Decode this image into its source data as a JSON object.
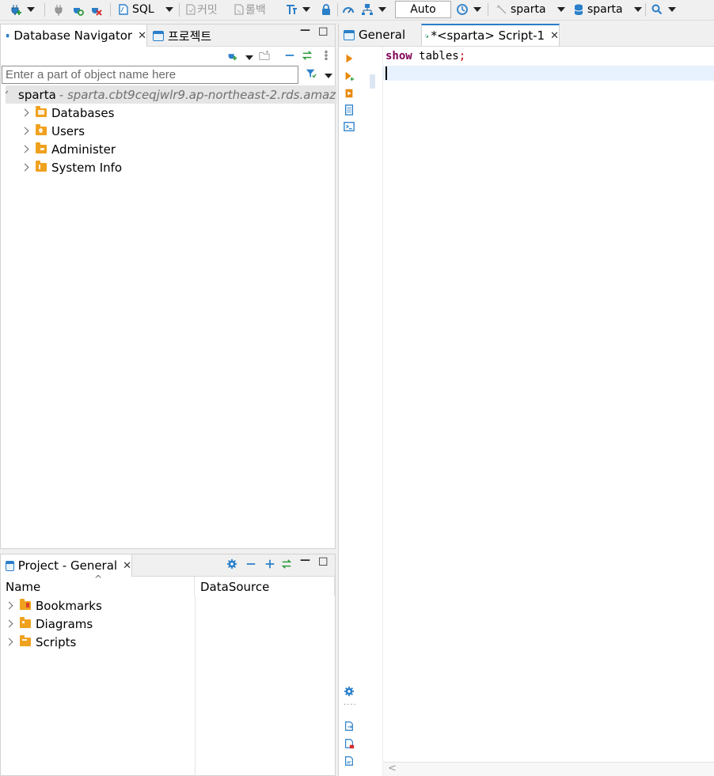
{
  "toolbar": {
    "sql_label": "SQL",
    "commit_label": "커밋",
    "rollback_label": "롤백",
    "auto_commit_mode": "Auto",
    "active_datasource": "sparta",
    "active_schema": "sparta"
  },
  "navigator": {
    "tabs": [
      {
        "label": "Database Navigator"
      },
      {
        "label": "프로젝트"
      }
    ],
    "filter_placeholder": "Enter a part of object name here",
    "connection": {
      "name": "sparta",
      "host": " - sparta.cbt9ceqjwlr9.ap-northeast-2.rds.amazonaws.com"
    },
    "items": [
      {
        "label": "Databases"
      },
      {
        "label": "Users"
      },
      {
        "label": "Administer"
      },
      {
        "label": "System Info"
      }
    ]
  },
  "project": {
    "tab_label": "Project - General",
    "columns": [
      "Name",
      "DataSource"
    ],
    "items": [
      {
        "label": "Bookmarks"
      },
      {
        "label": "Diagrams"
      },
      {
        "label": "Scripts"
      }
    ]
  },
  "editor": {
    "tabs": [
      {
        "label": "General"
      },
      {
        "label": "*<sparta> Script-1"
      }
    ],
    "code": {
      "keyword": "show",
      "text": " tables",
      "terminator": ";"
    }
  },
  "colors": {
    "accent_blue": "#2a7fc9",
    "folder_orange": "#f0a11e",
    "keyword": "#7f0055",
    "run_orange": "#e8890c",
    "connect_green": "#2e9b3c"
  }
}
